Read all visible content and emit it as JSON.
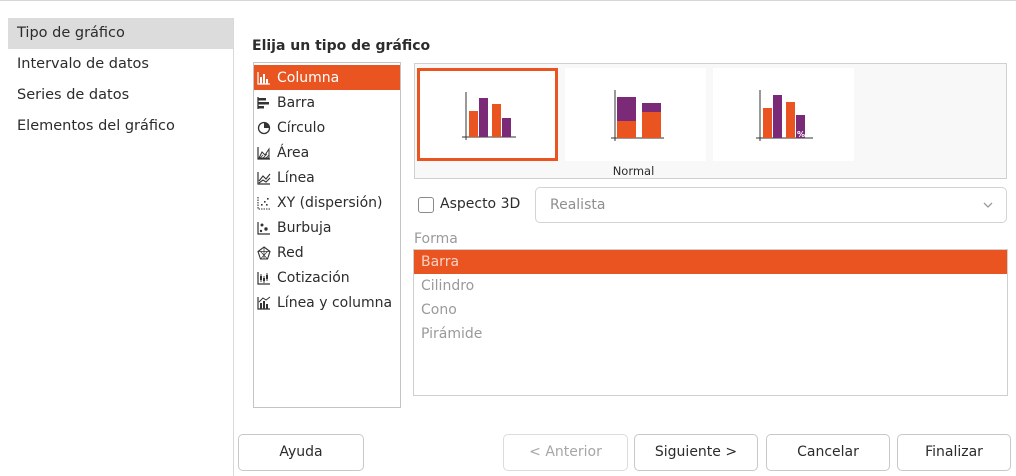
{
  "sidebar": {
    "items": [
      {
        "label": "Tipo de gráfico"
      },
      {
        "label": "Intervalo de datos"
      },
      {
        "label": "Series de datos"
      },
      {
        "label": "Elementos del gráfico"
      }
    ]
  },
  "main": {
    "title": "Elija un tipo de gráfico",
    "chart_types": [
      {
        "label": "Columna",
        "icon": "column-chart-icon"
      },
      {
        "label": "Barra",
        "icon": "bar-chart-icon"
      },
      {
        "label": "Círculo",
        "icon": "pie-chart-icon"
      },
      {
        "label": "Área",
        "icon": "area-chart-icon"
      },
      {
        "label": "Línea",
        "icon": "line-chart-icon"
      },
      {
        "label": "XY (dispersión)",
        "icon": "scatter-chart-icon"
      },
      {
        "label": "Burbuja",
        "icon": "bubble-chart-icon"
      },
      {
        "label": "Red",
        "icon": "net-chart-icon"
      },
      {
        "label": "Cotización",
        "icon": "stock-chart-icon"
      },
      {
        "label": "Línea y columna",
        "icon": "column-line-chart-icon"
      }
    ],
    "subtype_caption": "Normal",
    "aspect3d": {
      "label": "Aspecto 3D",
      "checked": false,
      "select_value": "Realista"
    },
    "shape": {
      "label": "Forma",
      "options": [
        "Barra",
        "Cilindro",
        "Cono",
        "Pirámide"
      ]
    }
  },
  "buttons": {
    "help": "Ayuda",
    "previous": "< Anterior",
    "next": "Siguiente >",
    "cancel": "Cancelar",
    "finish": "Finalizar"
  },
  "colors": {
    "accent": "#e95420",
    "series2": "#7b2a78",
    "selection_sidebar": "#dcdcdc"
  }
}
